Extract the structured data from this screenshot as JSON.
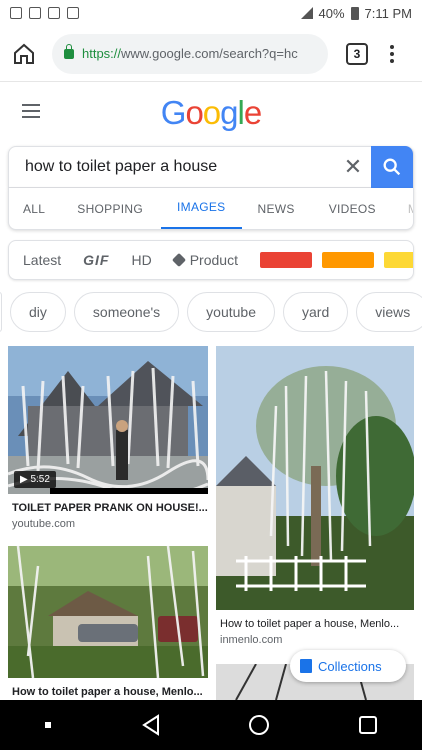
{
  "status": {
    "battery": "40%",
    "time": "7:11 PM"
  },
  "browser": {
    "url_scheme": "https://",
    "url_rest": "www.google.com/search?q=hc",
    "tab_count": "3"
  },
  "search": {
    "query": "how to toilet paper a house"
  },
  "tabs": [
    "ALL",
    "SHOPPING",
    "IMAGES",
    "NEWS",
    "VIDEOS",
    "MA"
  ],
  "filters": {
    "latest": "Latest",
    "gif": "GIF",
    "hd": "HD",
    "product": "Product"
  },
  "color_swatches": [
    "#ea4335",
    "#ff9800",
    "#fdd835"
  ],
  "chips": [
    "diy",
    "someone's",
    "youtube",
    "yard",
    "views"
  ],
  "results": [
    {
      "caption": "TOILET PAPER PRANK ON HOUSE!...",
      "source": "youtube.com",
      "duration": "5:52"
    },
    {
      "caption": "How to toilet paper a house, Menlo...",
      "source": "inmenlo.com"
    },
    {
      "caption": "How to toilet paper a house, Menlo..."
    }
  ],
  "collections_label": "Collections",
  "colors": {
    "accent": "#1a73e8",
    "google_blue": "#4285f4"
  }
}
